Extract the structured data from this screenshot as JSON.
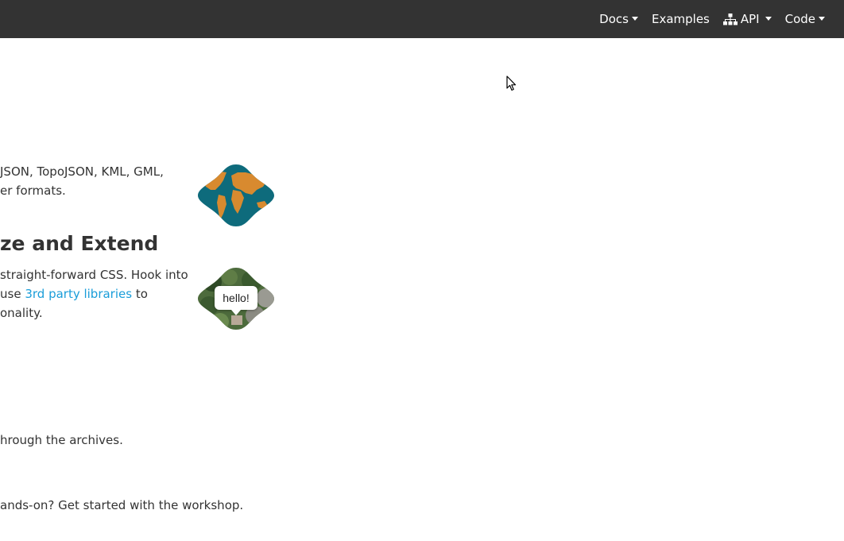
{
  "nav": {
    "docs": "Docs",
    "examples": "Examples",
    "api": "API",
    "code": "Code"
  },
  "features": {
    "formats_line1": "JSON, TopoJSON, KML, GML,",
    "formats_line2": "er formats.",
    "customize_title": "ze and Extend",
    "customize_line1": " straight-forward CSS. Hook into",
    "customize_line2_pre": "use ",
    "customize_link": "3rd party libraries",
    "customize_line2_post": " to",
    "customize_line3": "onality.",
    "popup_text": "hello!"
  },
  "resources": {
    "archives_text": "hrough the archives.",
    "workshop_text": "ands-on? Get started with the workshop."
  },
  "colors": {
    "navbar": "#333333",
    "link": "#1a9dd9",
    "ocean": "#0e6b7c",
    "land": "#d88a2f"
  }
}
